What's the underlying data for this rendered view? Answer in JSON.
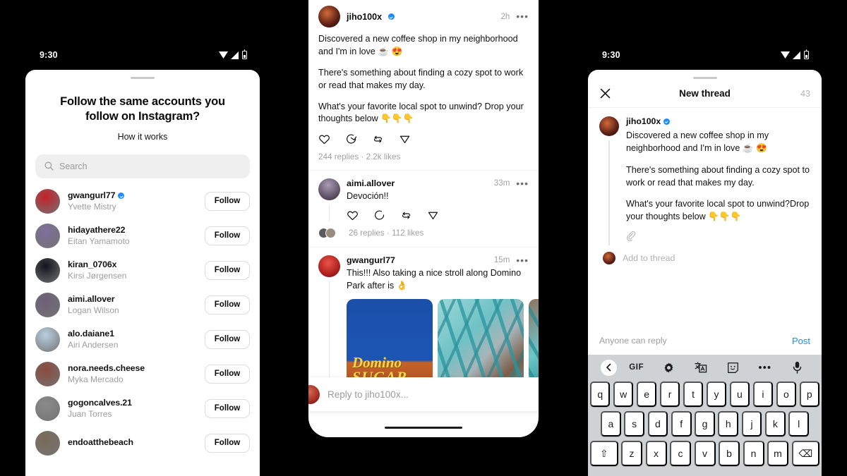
{
  "status_bar": {
    "time": "9:30"
  },
  "left_phone": {
    "title": "Follow the same accounts you follow on Instagram?",
    "subtitle": "How it works",
    "search_placeholder": "Search",
    "follow_label": "Follow",
    "accounts": [
      {
        "username": "gwangurl77",
        "name": "Yvette Mistry",
        "verified": true,
        "avatar": "#c4202a"
      },
      {
        "username": "hidayathere22",
        "name": "Eitan Yamamoto",
        "verified": false,
        "avatar": "#7e6f9a"
      },
      {
        "username": "kiran_0706x",
        "name": "Kirsi Jørgensen",
        "verified": false,
        "avatar": "#10131c"
      },
      {
        "username": "aimi.allover",
        "name": "Logan Wilson",
        "verified": false,
        "avatar": "#6d5f78"
      },
      {
        "username": "alo.daiane1",
        "name": "Airi Andersen",
        "verified": false,
        "avatar": "#b9cfe0"
      },
      {
        "username": "nora.needs.cheese",
        "name": "Myka Mercado",
        "verified": false,
        "avatar": "#8a4a3c"
      },
      {
        "username": "gogoncalves.21",
        "name": "Juan Torres",
        "verified": false,
        "avatar": "#8b8b8b"
      },
      {
        "username": "endoatthebeach",
        "name": "",
        "verified": false,
        "avatar": "#7a6b58"
      }
    ]
  },
  "center_phone": {
    "post": {
      "username": "jiho100x",
      "verified": true,
      "timestamp": "2h",
      "paragraphs": [
        "Discovered a new coffee shop in my neighborhood and I'm in love ☕ 😍",
        "There's something about finding a cozy spot to work or read that makes my day.",
        "What's your favorite local spot to unwind? Drop your thoughts below 👇👇👇"
      ],
      "stats": "244 replies · 2.2k likes"
    },
    "replies": [
      {
        "username": "aimi.allover",
        "timestamp": "33m",
        "text": "Devoción!!",
        "stats": "26 replies · 112 likes",
        "has_media": false
      },
      {
        "username": "gwangurl77",
        "timestamp": "15m",
        "text": "This!!! Also taking a nice stroll along Domino Park after is 👌",
        "stats": "",
        "has_media": true,
        "media": [
          "Domino SUGAR sign",
          "teal industrial structure",
          "teal scaffolding"
        ]
      }
    ],
    "reply_bar_placeholder": "Reply to jiho100x...",
    "menu_icon": "•••"
  },
  "right_phone": {
    "header": {
      "close_icon": "close-icon",
      "title": "New thread",
      "char_count": "43"
    },
    "composer": {
      "username": "jiho100x",
      "verified": true,
      "paragraphs": [
        "Discovered a new coffee shop in my neighborhood and I'm in love ☕ 😍",
        "There's something about finding a cozy spot to work or read that makes my day.",
        "What's your favorite local spot to unwind?Drop your thoughts below 👇👇👇"
      ],
      "attach_icon": "paperclip-icon",
      "add_to_thread": "Add to thread"
    },
    "footer": {
      "audience": "Anyone can reply",
      "post_label": "Post"
    },
    "keyboard": {
      "toolbar": [
        "back-chevron-icon",
        "GIF",
        "gear-icon",
        "translate-icon",
        "sticker-icon",
        "•••",
        "mic-icon"
      ],
      "gif_label": "GIF",
      "more_label": "•••",
      "row1": [
        "q",
        "w",
        "e",
        "r",
        "t",
        "y",
        "u",
        "i",
        "o",
        "p"
      ],
      "row2": [
        "a",
        "s",
        "d",
        "f",
        "g",
        "h",
        "j",
        "k",
        "l"
      ],
      "row3": [
        "⇧",
        "z",
        "x",
        "c",
        "v",
        "b",
        "n",
        "m",
        "⌫"
      ]
    }
  },
  "colors": {
    "accent_blue": "#1a8cff",
    "verified_blue": "#1a8cff",
    "muted_gray": "#9d9d9d",
    "keyboard_bg": "#cfd2d4"
  }
}
